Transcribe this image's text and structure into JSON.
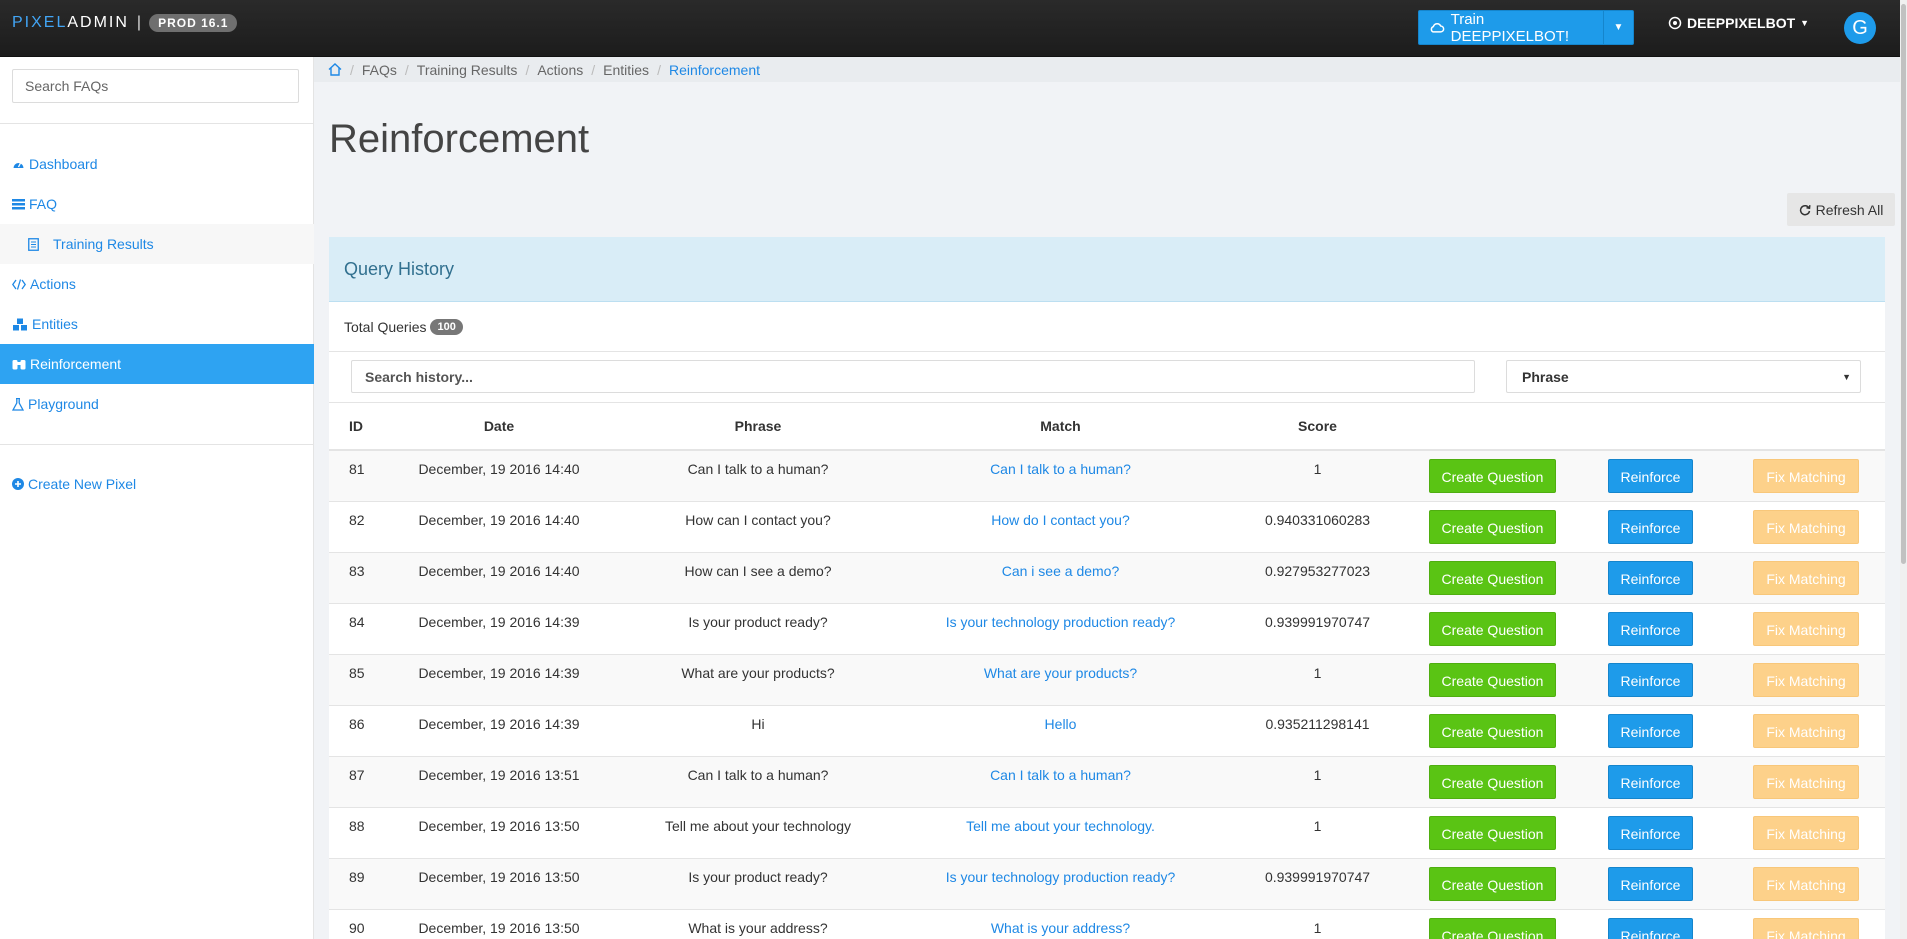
{
  "app": {
    "brand_part1": "PIXEL",
    "brand_part2": "ADMIN",
    "brand_separator": "|",
    "env_badge": "PROD 16.1",
    "train_button": "Train DEEPPIXELBOT!",
    "bot_menu": "DEEPPIXELBOT",
    "avatar_initial": "G"
  },
  "sidebar": {
    "search_placeholder": "Search FAQs",
    "items": [
      {
        "label": "Dashboard",
        "icon": "dashboard-icon"
      },
      {
        "label": "FAQ",
        "icon": "list-icon"
      },
      {
        "label": "Training Results",
        "icon": "document-icon"
      },
      {
        "label": "Actions",
        "icon": "code-icon"
      },
      {
        "label": "Entities",
        "icon": "cubes-icon"
      },
      {
        "label": "Reinforcement",
        "icon": "binoculars-icon",
        "active": true
      },
      {
        "label": "Playground",
        "icon": "flask-icon"
      }
    ],
    "create_label": "Create New Pixel"
  },
  "breadcrumb": [
    "FAQs",
    "Training Results",
    "Actions",
    "Entities",
    "Reinforcement"
  ],
  "page": {
    "title": "Reinforcement",
    "refresh_label": "Refresh All"
  },
  "query_history": {
    "title": "Query History",
    "total_label": "Total Queries",
    "total_count": "100",
    "search_placeholder": "Search history...",
    "filter_selected": "Phrase",
    "columns": [
      "ID",
      "Date",
      "Phrase",
      "Match",
      "Score"
    ],
    "buttons": {
      "create": "Create Question",
      "reinforce": "Reinforce",
      "fix": "Fix Matching"
    },
    "rows": [
      {
        "id": "81",
        "date": "December, 19 2016 14:40",
        "phrase": "Can I talk to a human?",
        "match": "Can I talk to a human?",
        "score": "1"
      },
      {
        "id": "82",
        "date": "December, 19 2016 14:40",
        "phrase": "How can I contact you?",
        "match": "How do I contact you?",
        "score": "0.940331060283"
      },
      {
        "id": "83",
        "date": "December, 19 2016 14:40",
        "phrase": "How can I see a demo?",
        "match": "Can i see a demo?",
        "score": "0.927953277023"
      },
      {
        "id": "84",
        "date": "December, 19 2016 14:39",
        "phrase": "Is your product ready?",
        "match": "Is your technology production ready?",
        "score": "0.939991970747"
      },
      {
        "id": "85",
        "date": "December, 19 2016 14:39",
        "phrase": "What are your products?",
        "match": "What are your products?",
        "score": "1"
      },
      {
        "id": "86",
        "date": "December, 19 2016 14:39",
        "phrase": "Hi",
        "match": "Hello",
        "score": "0.935211298141"
      },
      {
        "id": "87",
        "date": "December, 19 2016 13:51",
        "phrase": "Can I talk to a human?",
        "match": "Can I talk to a human?",
        "score": "1"
      },
      {
        "id": "88",
        "date": "December, 19 2016 13:50",
        "phrase": "Tell me about your technology",
        "match": "Tell me about your technology.",
        "score": "1"
      },
      {
        "id": "89",
        "date": "December, 19 2016 13:50",
        "phrase": "Is your product ready?",
        "match": "Is your technology production ready?",
        "score": "0.939991970747"
      },
      {
        "id": "90",
        "date": "December, 19 2016 13:50",
        "phrase": "What is your address?",
        "match": "What is your address?",
        "score": "1"
      }
    ]
  },
  "colors": {
    "accent": "#1e9bea",
    "green": "#5ac414",
    "orange": "#fdd18a",
    "panel_header": "#d9edf7"
  }
}
